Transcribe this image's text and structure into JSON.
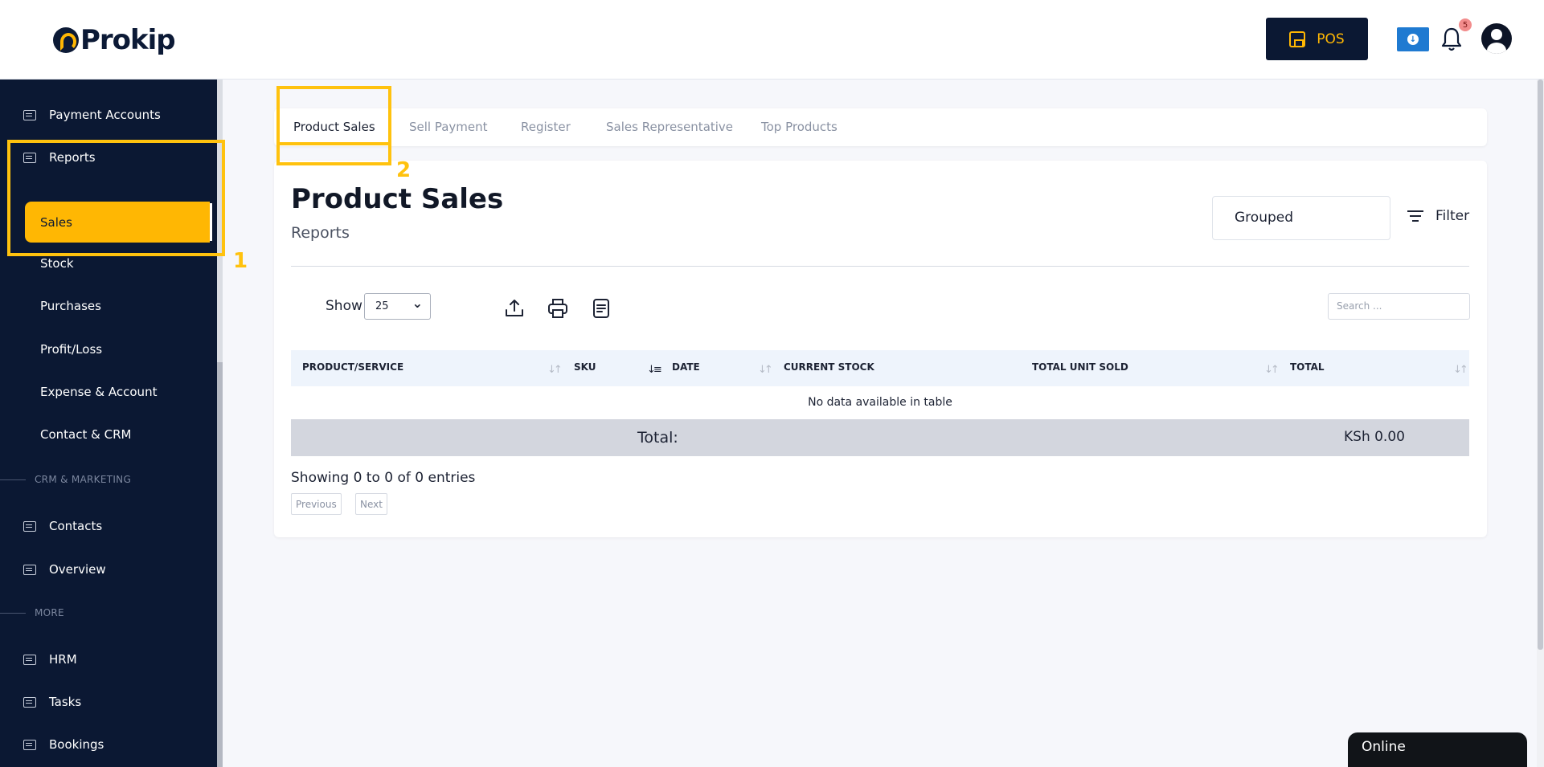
{
  "header": {
    "logo_text": "Prokip",
    "pos_label": "POS",
    "notification_count": "5"
  },
  "sidebar": {
    "top_items": [
      {
        "label": "Payment Accounts",
        "icon": "wallet-icon"
      },
      {
        "label": "Reports",
        "icon": "presentation-icon"
      }
    ],
    "reports_sub": {
      "active": "Sales",
      "items": [
        "Stock",
        "Purchases",
        "Profit/Loss",
        "Expense & Account",
        "Contact & CRM"
      ]
    },
    "section_crm": "CRM & MARKETING",
    "crm_items": [
      {
        "label": "Contacts",
        "icon": "contacts-icon"
      },
      {
        "label": "Overview",
        "icon": "id-card-icon"
      }
    ],
    "section_more": "MORE",
    "more_items": [
      {
        "label": "HRM",
        "icon": "id-card-icon"
      },
      {
        "label": "Tasks",
        "icon": "tasks-icon"
      },
      {
        "label": "Bookings",
        "icon": "calendar-icon"
      }
    ]
  },
  "annotations": {
    "one": "1",
    "two": "2",
    "color": "#ffc20e"
  },
  "tabs": [
    "Product Sales",
    "Sell Payment",
    "Register",
    "Sales Representative",
    "Top Products"
  ],
  "page": {
    "title": "Product Sales",
    "subtitle": "Reports",
    "group_select": "Grouped",
    "filter_label": "Filter"
  },
  "table_controls": {
    "show_label": "Show",
    "page_size": "25",
    "search_placeholder": "Search ..."
  },
  "table": {
    "columns": [
      "PRODUCT/SERVICE",
      "SKU",
      "DATE",
      "CURRENT STOCK",
      "TOTAL UNIT SOLD",
      "TOTAL"
    ],
    "empty_text": "No data available in table",
    "footer_label": "Total:",
    "footer_value": "KSh 0.00"
  },
  "pagination": {
    "entries_text": "Showing 0 to 0 of 0 entries",
    "previous": "Previous",
    "next": "Next"
  },
  "status": {
    "online": "Online"
  },
  "colors": {
    "sidebar_bg": "#0b1833",
    "accent": "#ffb703",
    "table_header_bg": "#eef4fc",
    "table_footer_bg": "#d3d6de"
  }
}
